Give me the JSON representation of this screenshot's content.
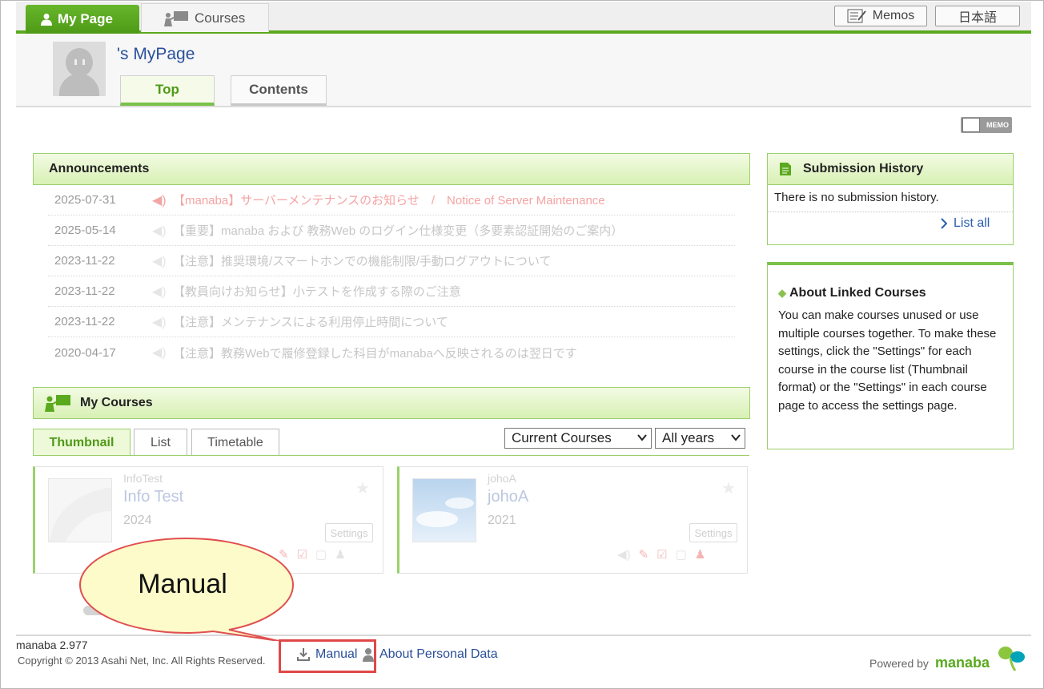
{
  "nav": {
    "my_page": "My Page",
    "courses": "Courses",
    "memos": "Memos",
    "language": "日本語"
  },
  "profile": {
    "title": "'s MyPage",
    "tabs": [
      "Top",
      "Contents"
    ],
    "memo_badge": "MEMO"
  },
  "announcements": {
    "title": "Announcements",
    "items": [
      {
        "date": "2025-07-31",
        "text": "【manaba】サーバーメンテナンスのお知らせ　/　Notice of Server Maintenance",
        "highlight": true
      },
      {
        "date": "2025-05-14",
        "text": "【重要】manaba および 教務Web のログイン仕様変更（多要素認証開始のご案内）",
        "highlight": false
      },
      {
        "date": "2023-11-22",
        "text": "【注意】推奨環境/スマートホンでの機能制限/手動ログアウトについて",
        "highlight": false
      },
      {
        "date": "2023-11-22",
        "text": "【教員向けお知らせ】小テストを作成する際のご注意",
        "highlight": false
      },
      {
        "date": "2023-11-22",
        "text": "【注意】メンテナンスによる利用停止時間について",
        "highlight": false
      },
      {
        "date": "2020-04-17",
        "text": "【注意】教務Webで履修登録した科目がmanabaへ反映されるのは翌日です",
        "highlight": false
      }
    ]
  },
  "my_courses": {
    "title": "My Courses",
    "tabs": [
      "Thumbnail",
      "List",
      "Timetable"
    ],
    "filter_status": "Current Courses",
    "filter_year": "All years",
    "cards": [
      {
        "code": "InfoTest",
        "name": "Info Test",
        "year": "2024",
        "settings": "Settings"
      },
      {
        "code": "johoA",
        "name": "johoA",
        "year": "2021",
        "settings": "Settings"
      }
    ]
  },
  "submission_history": {
    "title": "Submission History",
    "empty": "There is no submission history.",
    "list_all": "List all"
  },
  "linked_courses": {
    "title": "About Linked Courses",
    "body": "You can make courses unused or use multiple courses together. To make these settings, click the \"Settings\" for each course in the course list (Thumbnail format) or the \"Settings\" in each course page to access the settings page."
  },
  "footer": {
    "version": "manaba 2.977",
    "copyright": "Copyright © 2013 Asahi Net, Inc. All Rights Reserved.",
    "manual": "Manual",
    "personal_data": "About Personal Data",
    "powered_by": "Powered by",
    "brand": "manaba"
  },
  "callout": {
    "text": "Manual"
  },
  "colors": {
    "accent_green": "#5aa91e",
    "link_blue": "#2a4f9a",
    "highlight_red": "#e04848"
  }
}
